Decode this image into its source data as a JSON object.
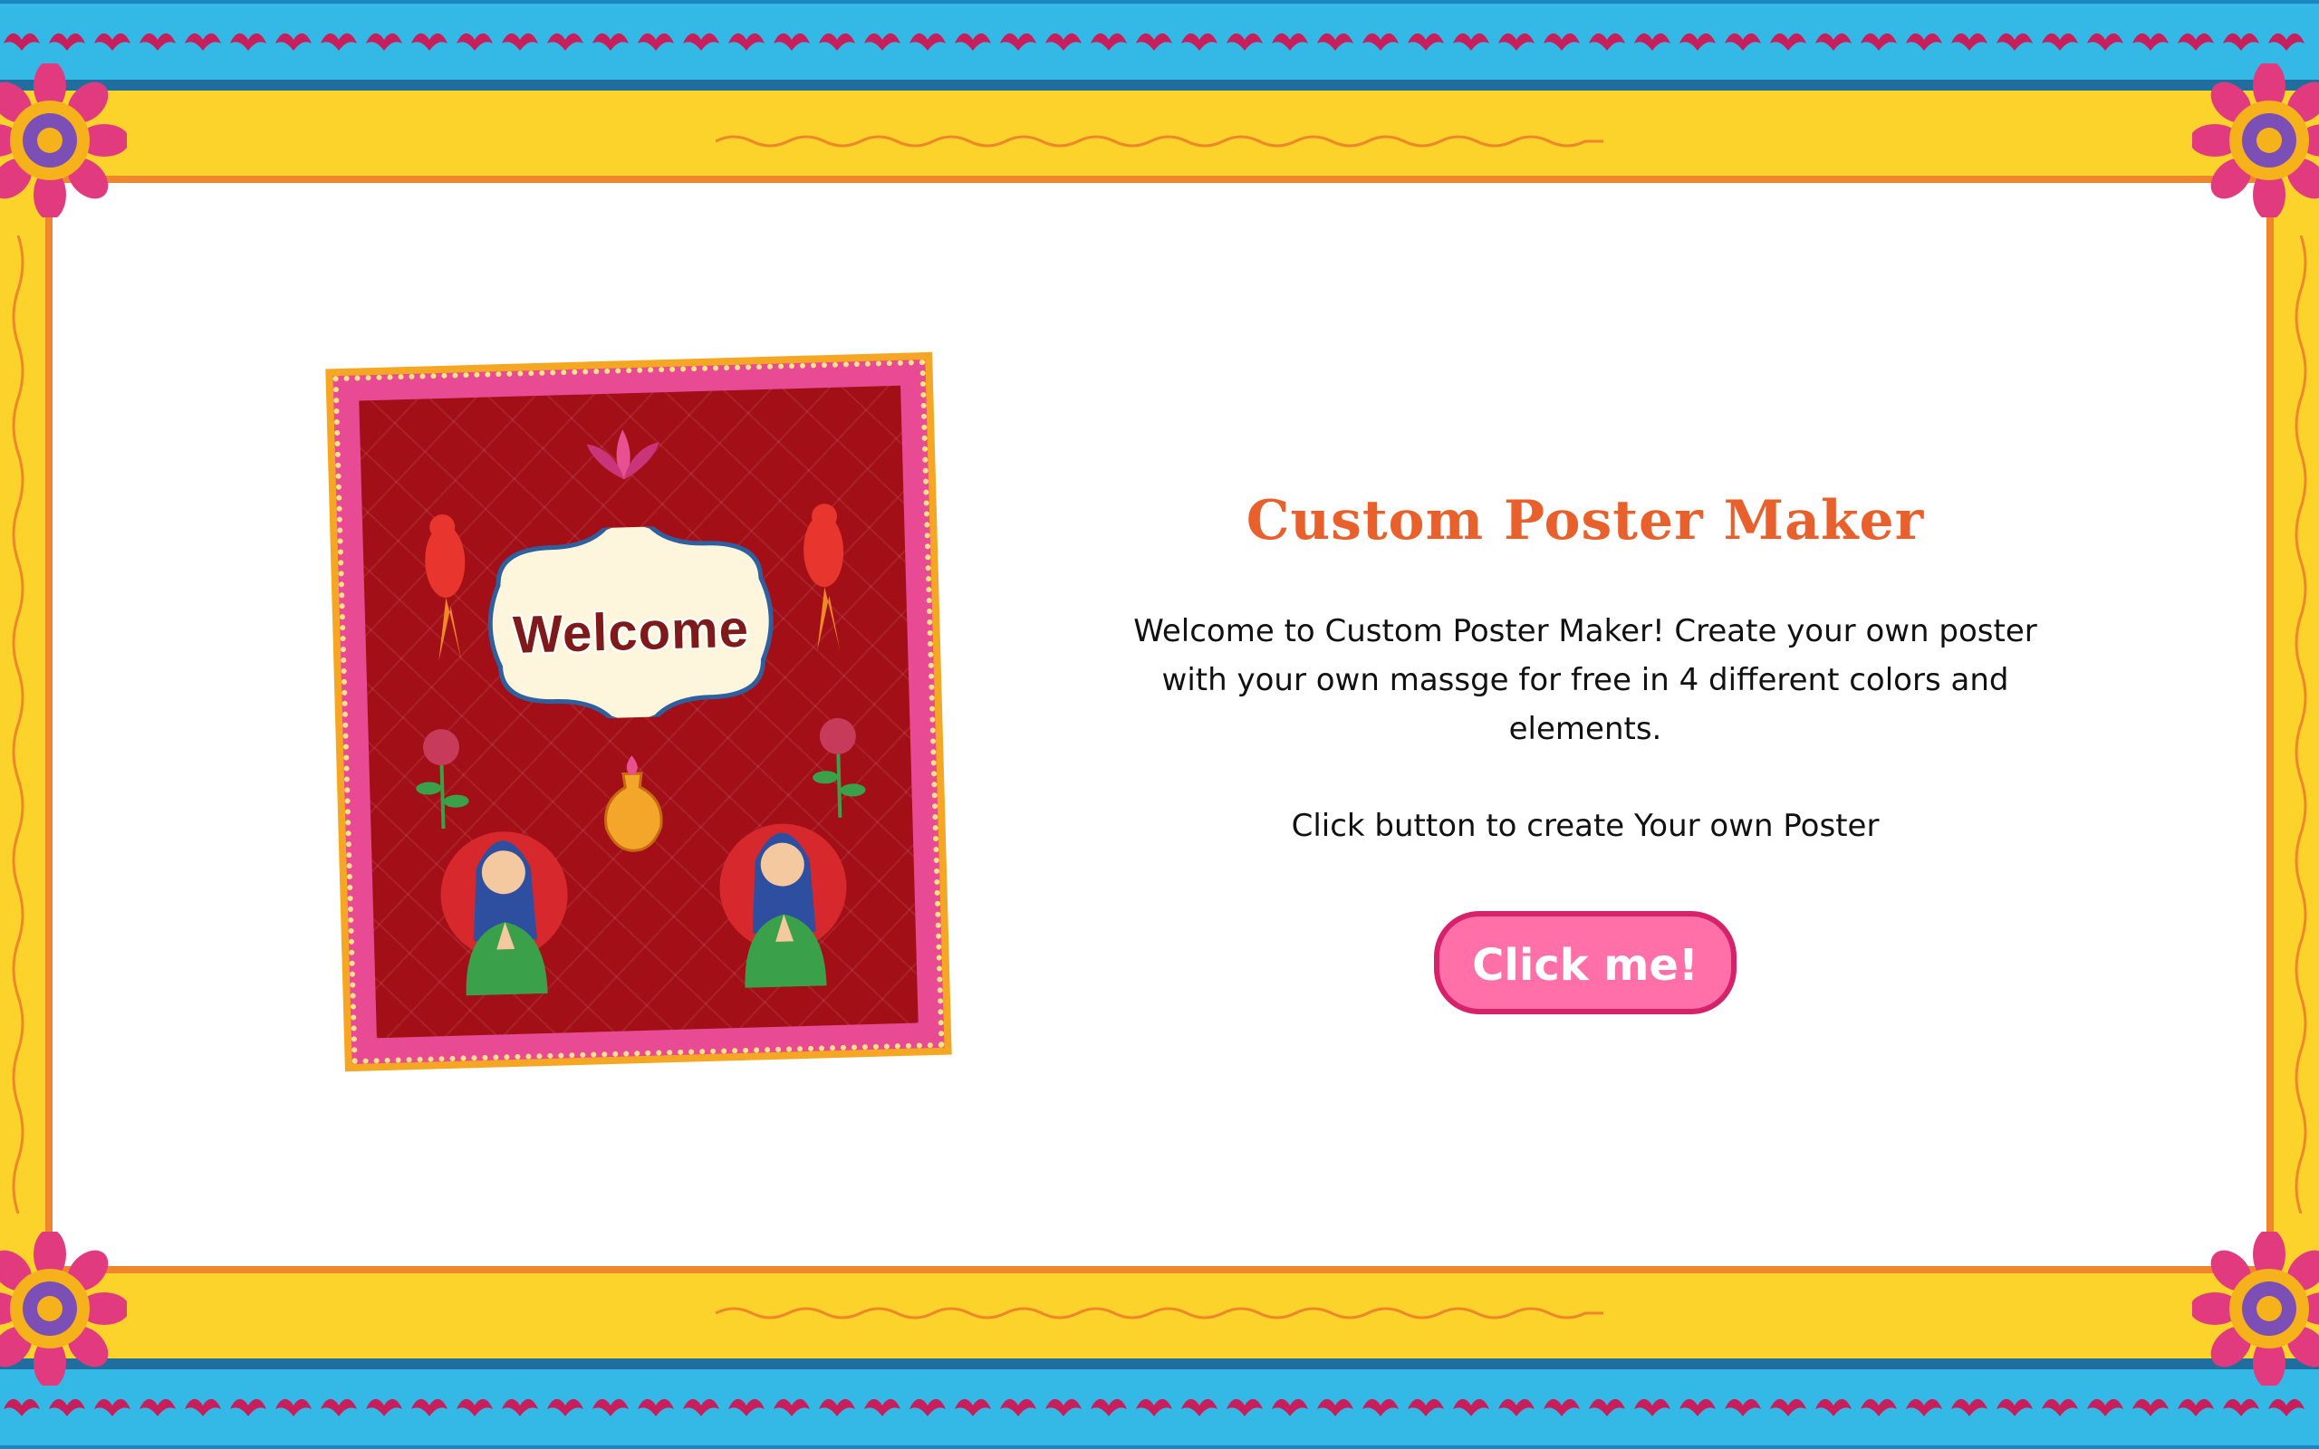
{
  "page": {
    "title": "Custom Poster Maker",
    "description": "Welcome to Custom Poster Maker! Create your own poster with your own massge for free in 4 different colors and elements.",
    "cta_text": "Click button to create Your own Poster",
    "button_label": "Click me!"
  },
  "poster": {
    "welcome_text": "Welcome"
  },
  "colors": {
    "title": "#e8602c",
    "button_bg": "#ff6fa8",
    "button_border": "#d6226b",
    "frame_yellow": "#fcd32b",
    "frame_blue": "#34b8e6",
    "frame_orange": "#f0862b",
    "poster_red": "#a30f17",
    "poster_pink": "#e84b93"
  },
  "decor": {
    "corner_icon": "flower-icon",
    "border_icon": "lotus-icon",
    "divider_icon": "swirl-divider-icon"
  }
}
